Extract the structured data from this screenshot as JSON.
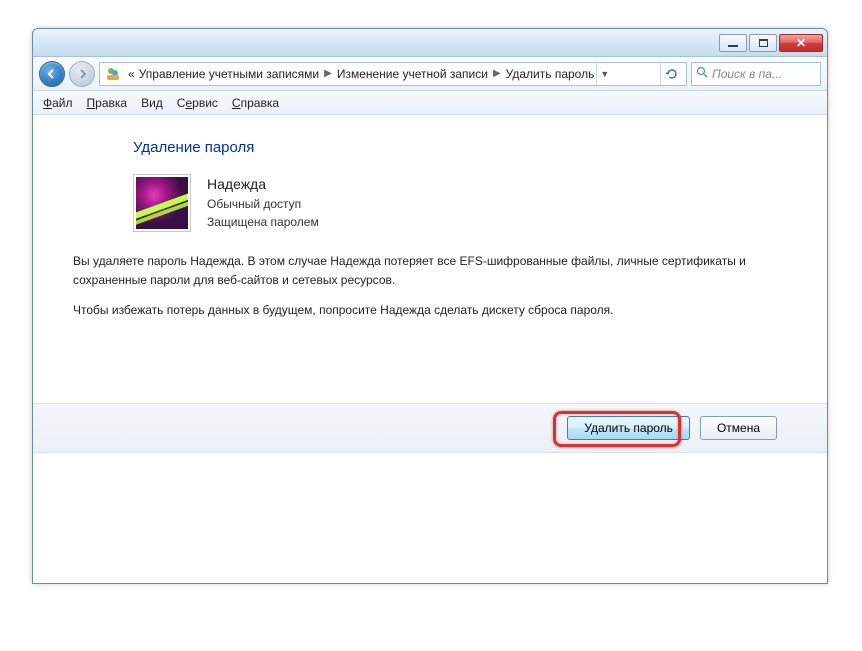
{
  "window": {
    "min_tooltip": "Minimize",
    "max_tooltip": "Maximize",
    "close_tooltip": "Close"
  },
  "breadcrumb": {
    "prefix": "«",
    "segments": [
      "Управление учетными записями",
      "Изменение учетной записи",
      "Удалить пароль"
    ]
  },
  "search": {
    "placeholder": "Поиск в па..."
  },
  "menu": {
    "file": "Файл",
    "edit": "Правка",
    "view": "Вид",
    "tools": "Сервис",
    "help": "Справка"
  },
  "page": {
    "title": "Удаление пароля",
    "user": {
      "name": "Надежда",
      "type": "Обычный доступ",
      "status": "Защищена паролем"
    },
    "paragraph1": "Вы удаляете пароль Надежда. В этом случае Надежда потеряет все EFS-шифрованные файлы, личные сертификаты и сохраненные пароли для веб-сайтов и сетевых ресурсов.",
    "paragraph2": "Чтобы избежать потерь данных в будущем, попросите Надежда сделать дискету сброса пароля."
  },
  "buttons": {
    "delete": "Удалить пароль",
    "cancel": "Отмена"
  }
}
